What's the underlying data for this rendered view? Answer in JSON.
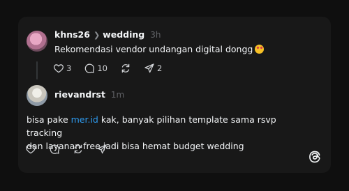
{
  "post": {
    "username": "khns26",
    "topic": "wedding",
    "time": "3h",
    "text": "Rekomendasi vendor undangan digital dongg",
    "emoji": "smiling-face-with-hearts",
    "likes": "3",
    "comments": "10",
    "shares": "2"
  },
  "reply": {
    "username": "rievandrst",
    "time": "1m",
    "text_before_link": "bisa pake ",
    "link": "mer.id",
    "text_after_link_line1": " kak, banyak pilihan template sama rsvp tracking",
    "text_line2": "dan layanan free jadi bisa hemat budget wedding"
  },
  "icons": {
    "like": "heart-icon",
    "comment": "comment-icon",
    "repost": "repost-icon",
    "share": "send-icon",
    "brand": "threads-logo-icon"
  },
  "colors": {
    "background": "#0f0f0f",
    "card": "#181818",
    "text": "#f3f5f7",
    "muted": "#616367",
    "link": "#2e9bf0"
  }
}
